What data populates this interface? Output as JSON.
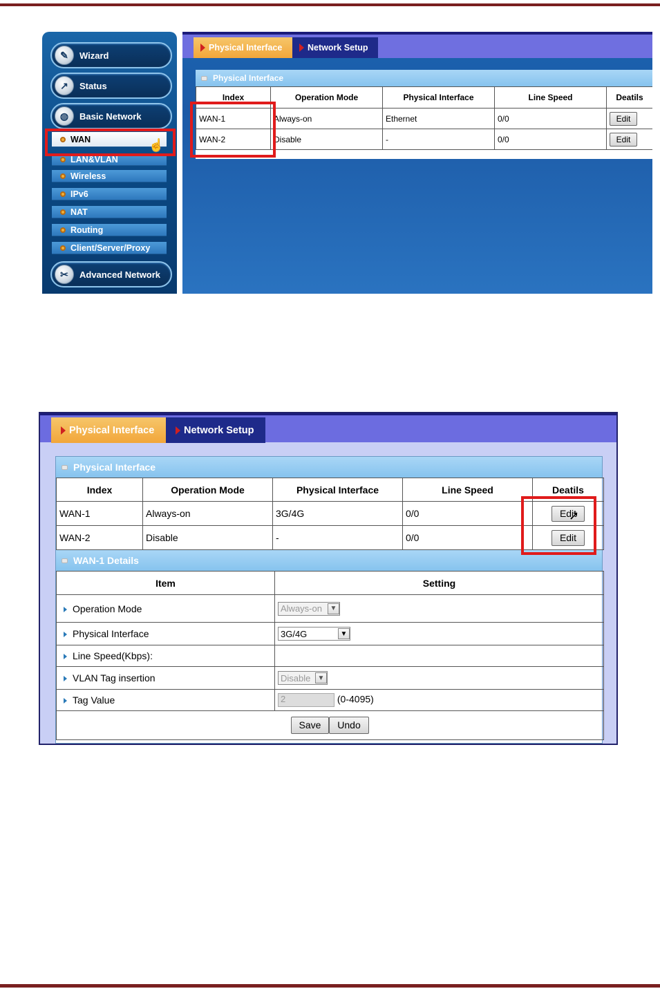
{
  "sidebar": {
    "main_items": [
      {
        "label": "Wizard",
        "icon": "wizard-icon"
      },
      {
        "label": "Status",
        "icon": "status-chart-icon"
      },
      {
        "label": "Basic Network",
        "icon": "globe-icon"
      },
      {
        "label": "Advanced Network",
        "icon": "tools-icon"
      }
    ],
    "sub_items": [
      "WAN",
      "LAN&VLAN",
      "Wireless",
      "IPv6",
      "NAT",
      "Routing",
      "Client/Server/Proxy"
    ]
  },
  "tabs": {
    "active": "Physical Interface",
    "other": "Network Setup"
  },
  "panel_title": "Physical Interface",
  "table_headers": [
    "Index",
    "Operation Mode",
    "Physical Interface",
    "Line Speed",
    "Deatils"
  ],
  "shot1_rows": [
    {
      "index": "WAN-1",
      "mode": "Always-on",
      "iface": "Ethernet",
      "speed": "0/0",
      "action": "Edit"
    },
    {
      "index": "WAN-2",
      "mode": "Disable",
      "iface": "-",
      "speed": "0/0",
      "action": "Edit"
    }
  ],
  "shot2_rows": [
    {
      "index": "WAN-1",
      "mode": "Always-on",
      "iface": "3G/4G",
      "speed": "0/0",
      "action": "Edit"
    },
    {
      "index": "WAN-2",
      "mode": "Disable",
      "iface": "-",
      "speed": "0/0",
      "action": "Edit"
    }
  ],
  "details": {
    "title": "WAN-1 Details",
    "headers": [
      "Item",
      "Setting"
    ],
    "rows": [
      {
        "label": "Operation Mode",
        "value": "Always-on"
      },
      {
        "label": "Physical Interface",
        "value": "3G/4G"
      },
      {
        "label": "Line Speed(Kbps):",
        "value": ""
      },
      {
        "label": "VLAN Tag insertion",
        "value": "Disable"
      },
      {
        "label": "Tag Value",
        "value": "2",
        "hint": "(0-4095)"
      }
    ],
    "save_label": "Save",
    "undo_label": "Undo"
  },
  "colors": {
    "highlight": "#e01b1b",
    "active_tab": "#f2a63a",
    "tab_bar": "#6f6fe0",
    "panel_header": "#86c3ee"
  }
}
